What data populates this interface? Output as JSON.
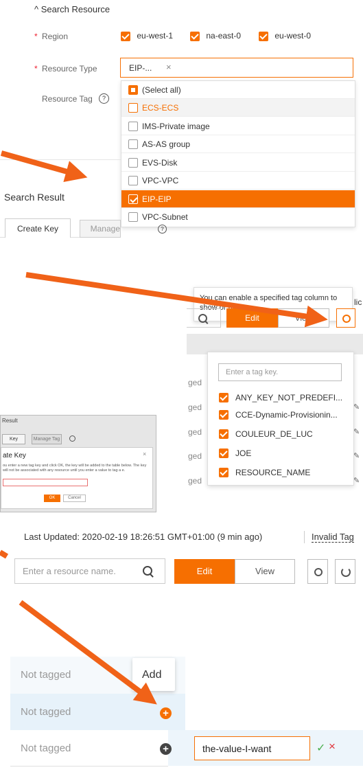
{
  "search_panel": {
    "toggle_label": "^ Search Resource",
    "region_label": "Region",
    "regions": [
      "eu-west-1",
      "na-east-0",
      "eu-west-0"
    ],
    "resource_type_label": "Resource Type",
    "resource_type_value": "EIP-...",
    "resource_type_clear": "×",
    "resource_tag_label": "Resource Tag",
    "required_mark": "*",
    "help_icon": "?"
  },
  "resource_dropdown": {
    "items": [
      {
        "label": "(Select all)",
        "state": "partial"
      },
      {
        "label": "ECS-ECS",
        "state": "off",
        "highlight": "text"
      },
      {
        "label": "IMS-Private image",
        "state": "off"
      },
      {
        "label": "AS-AS group",
        "state": "off"
      },
      {
        "label": "EVS-Disk",
        "state": "off"
      },
      {
        "label": "VPC-VPC",
        "state": "off"
      },
      {
        "label": "EIP-EIP",
        "state": "on",
        "highlight": "row"
      },
      {
        "label": "VPC-Subnet",
        "state": "off"
      }
    ]
  },
  "search_result": {
    "title": "Search Result",
    "create_key": "Create Key",
    "manage_tag": "Manage Tag"
  },
  "tag_columns": {
    "tooltip": "You can enable a specified tag column to show or hide.",
    "tooltip_overflow": "lic",
    "edit": "Edit",
    "view": "View",
    "search_placeholder": "Enter a tag key.",
    "tagged_fragment": "ged",
    "keys": [
      "ANY_KEY_NOT_PREDEFI...",
      "CCE-Dynamic-Provisionin...",
      "COULEUR_DE_LUC",
      "JOE",
      "RESOURCE_NAME"
    ]
  },
  "create_key_dialog": {
    "result_label": "Result",
    "key_tab": "Key",
    "manage_tag_tab": "Manage Tag",
    "title": "ate Key",
    "close": "×",
    "body": "ou enter a new tag key and click OK, the key will be added to the table below. The key will not be associated with any resource until you enter a value to tag a e.",
    "ok": "OK",
    "cancel": "Cancel"
  },
  "toolbar": {
    "last_updated": "Last Updated: 2020-02-19 18:26:51 GMT+01:00 (9 min ago)",
    "invalid_tag": "Invalid Tag",
    "resource_placeholder": "Enter a resource name.",
    "edit": "Edit",
    "view": "View"
  },
  "tag_values": {
    "rows": [
      "Not tagged",
      "Not tagged",
      "Not tagged"
    ],
    "add_tooltip": "Add",
    "input_value": "the-value-I-want",
    "confirm": "✓",
    "cancel": "×"
  },
  "colors": {
    "accent": "#f66f01",
    "arrow": "#f06218"
  }
}
